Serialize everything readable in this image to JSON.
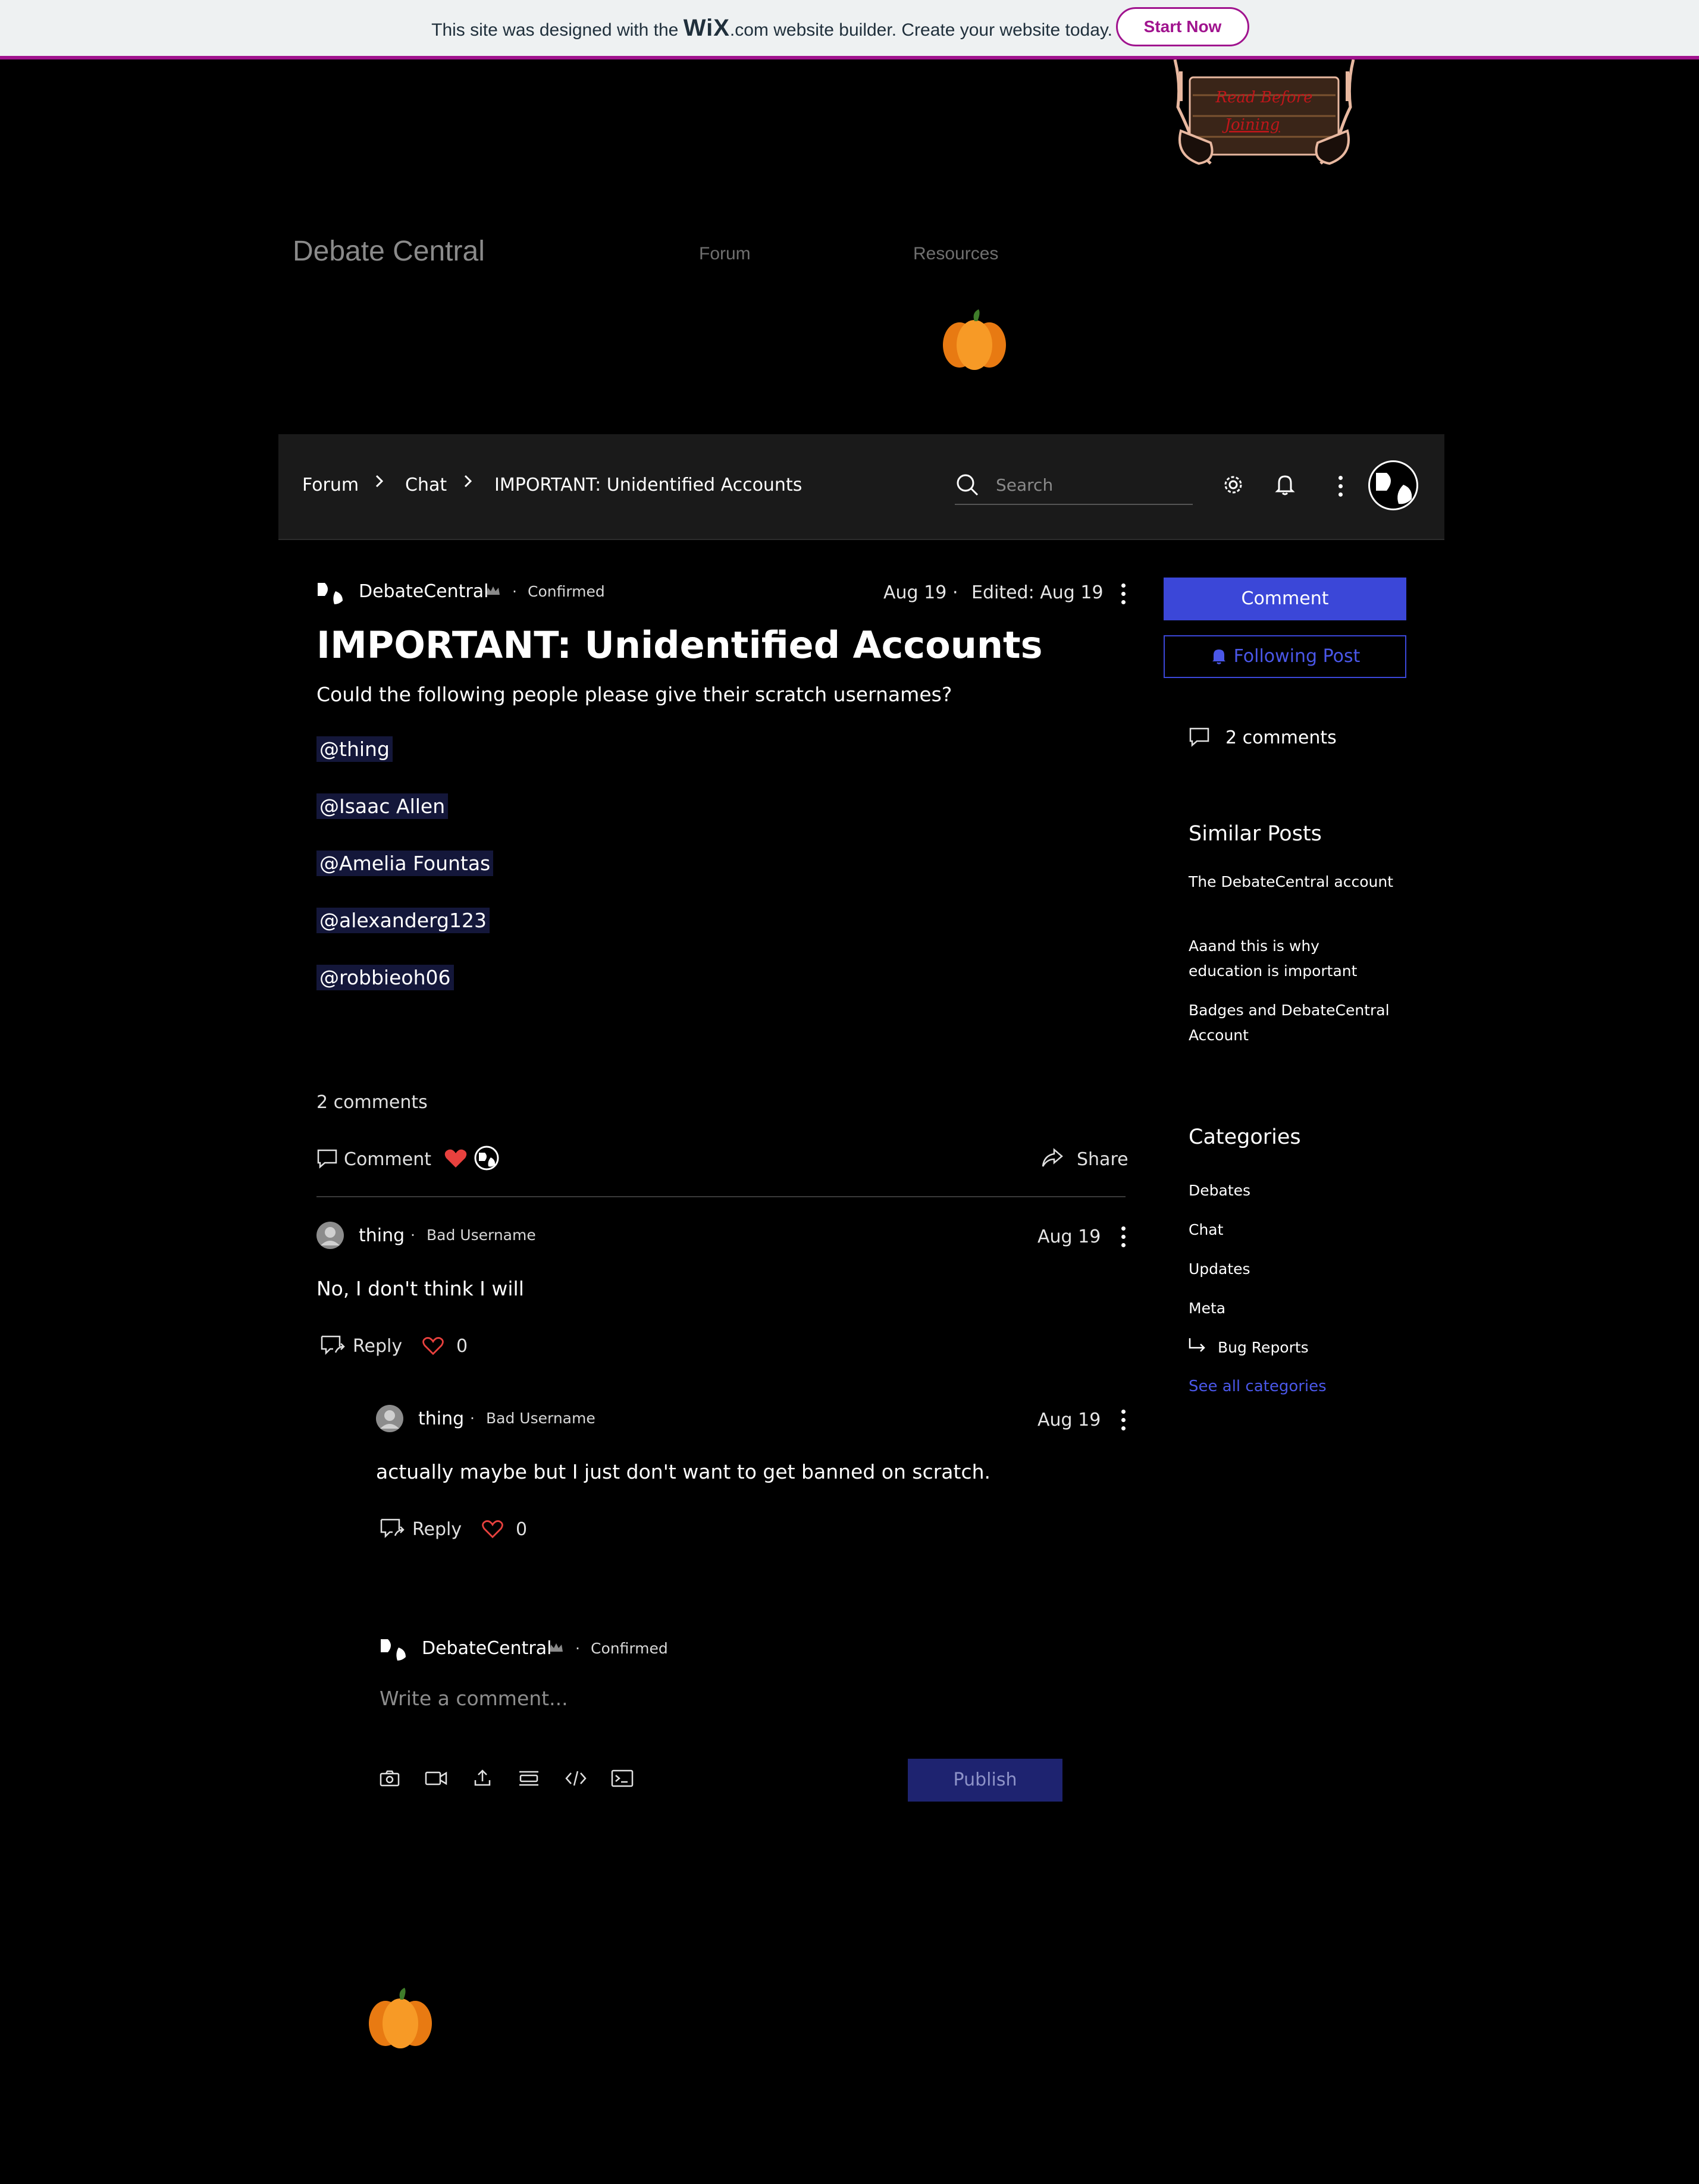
{
  "banner": {
    "text_before": "This site was designed with the",
    "wix_logo": "WiX",
    "text_after": ".com website builder. Create your website today.",
    "cta": "Start Now"
  },
  "header": {
    "site_name": "Debate Central",
    "nav": [
      "Forum",
      "Resources"
    ],
    "sign_text_line1": "Read Before",
    "sign_text_line2": "Joining"
  },
  "forum_bar": {
    "breadcrumbs": [
      "Forum",
      "Chat",
      "IMPORTANT: Unidentified Accounts"
    ],
    "search_placeholder": "Search"
  },
  "post": {
    "author": "DebateCentral",
    "badge": "Confirmed",
    "date": "Aug 19",
    "edited": "Edited: Aug 19",
    "title": "IMPORTANT: Unidentified Accounts",
    "body": "Could the following people please give their scratch usernames?",
    "mentions": [
      "@thing",
      "@Isaac Allen",
      "@Amelia Fountas",
      "@alexanderg123",
      "@robbieoh06"
    ],
    "comments_count": "2 comments",
    "comment_action": "Comment",
    "share_action": "Share"
  },
  "comments": [
    {
      "author": "thing",
      "badge": "Bad Username",
      "date": "Aug 19",
      "text": "No, I don't think I will",
      "reply": "Reply",
      "likes": "0"
    },
    {
      "author": "thing",
      "badge": "Bad Username",
      "date": "Aug 19",
      "text": "actually maybe but I just don't want to get banned on scratch.",
      "reply": "Reply",
      "likes": "0"
    }
  ],
  "composer": {
    "author": "DebateCentral",
    "badge": "Confirmed",
    "placeholder": "Write a comment...",
    "publish": "Publish"
  },
  "sidebar": {
    "comment_button": "Comment",
    "follow_button": "Following Post",
    "comments_count": "2 comments",
    "similar_title": "Similar Posts",
    "similar_posts": [
      "The DebateCentral account",
      "Aaand this is why education is important",
      "Badges and DebateCentral Account"
    ],
    "categories_title": "Categories",
    "categories": [
      "Debates",
      "Chat",
      "Updates",
      "Meta"
    ],
    "subcategory": "Bug Reports",
    "see_all": "See all categories"
  },
  "colors": {
    "accent": "#3b47d8",
    "wix_brand": "#a0138e",
    "like_red": "#e8413e",
    "background": "#000000"
  }
}
